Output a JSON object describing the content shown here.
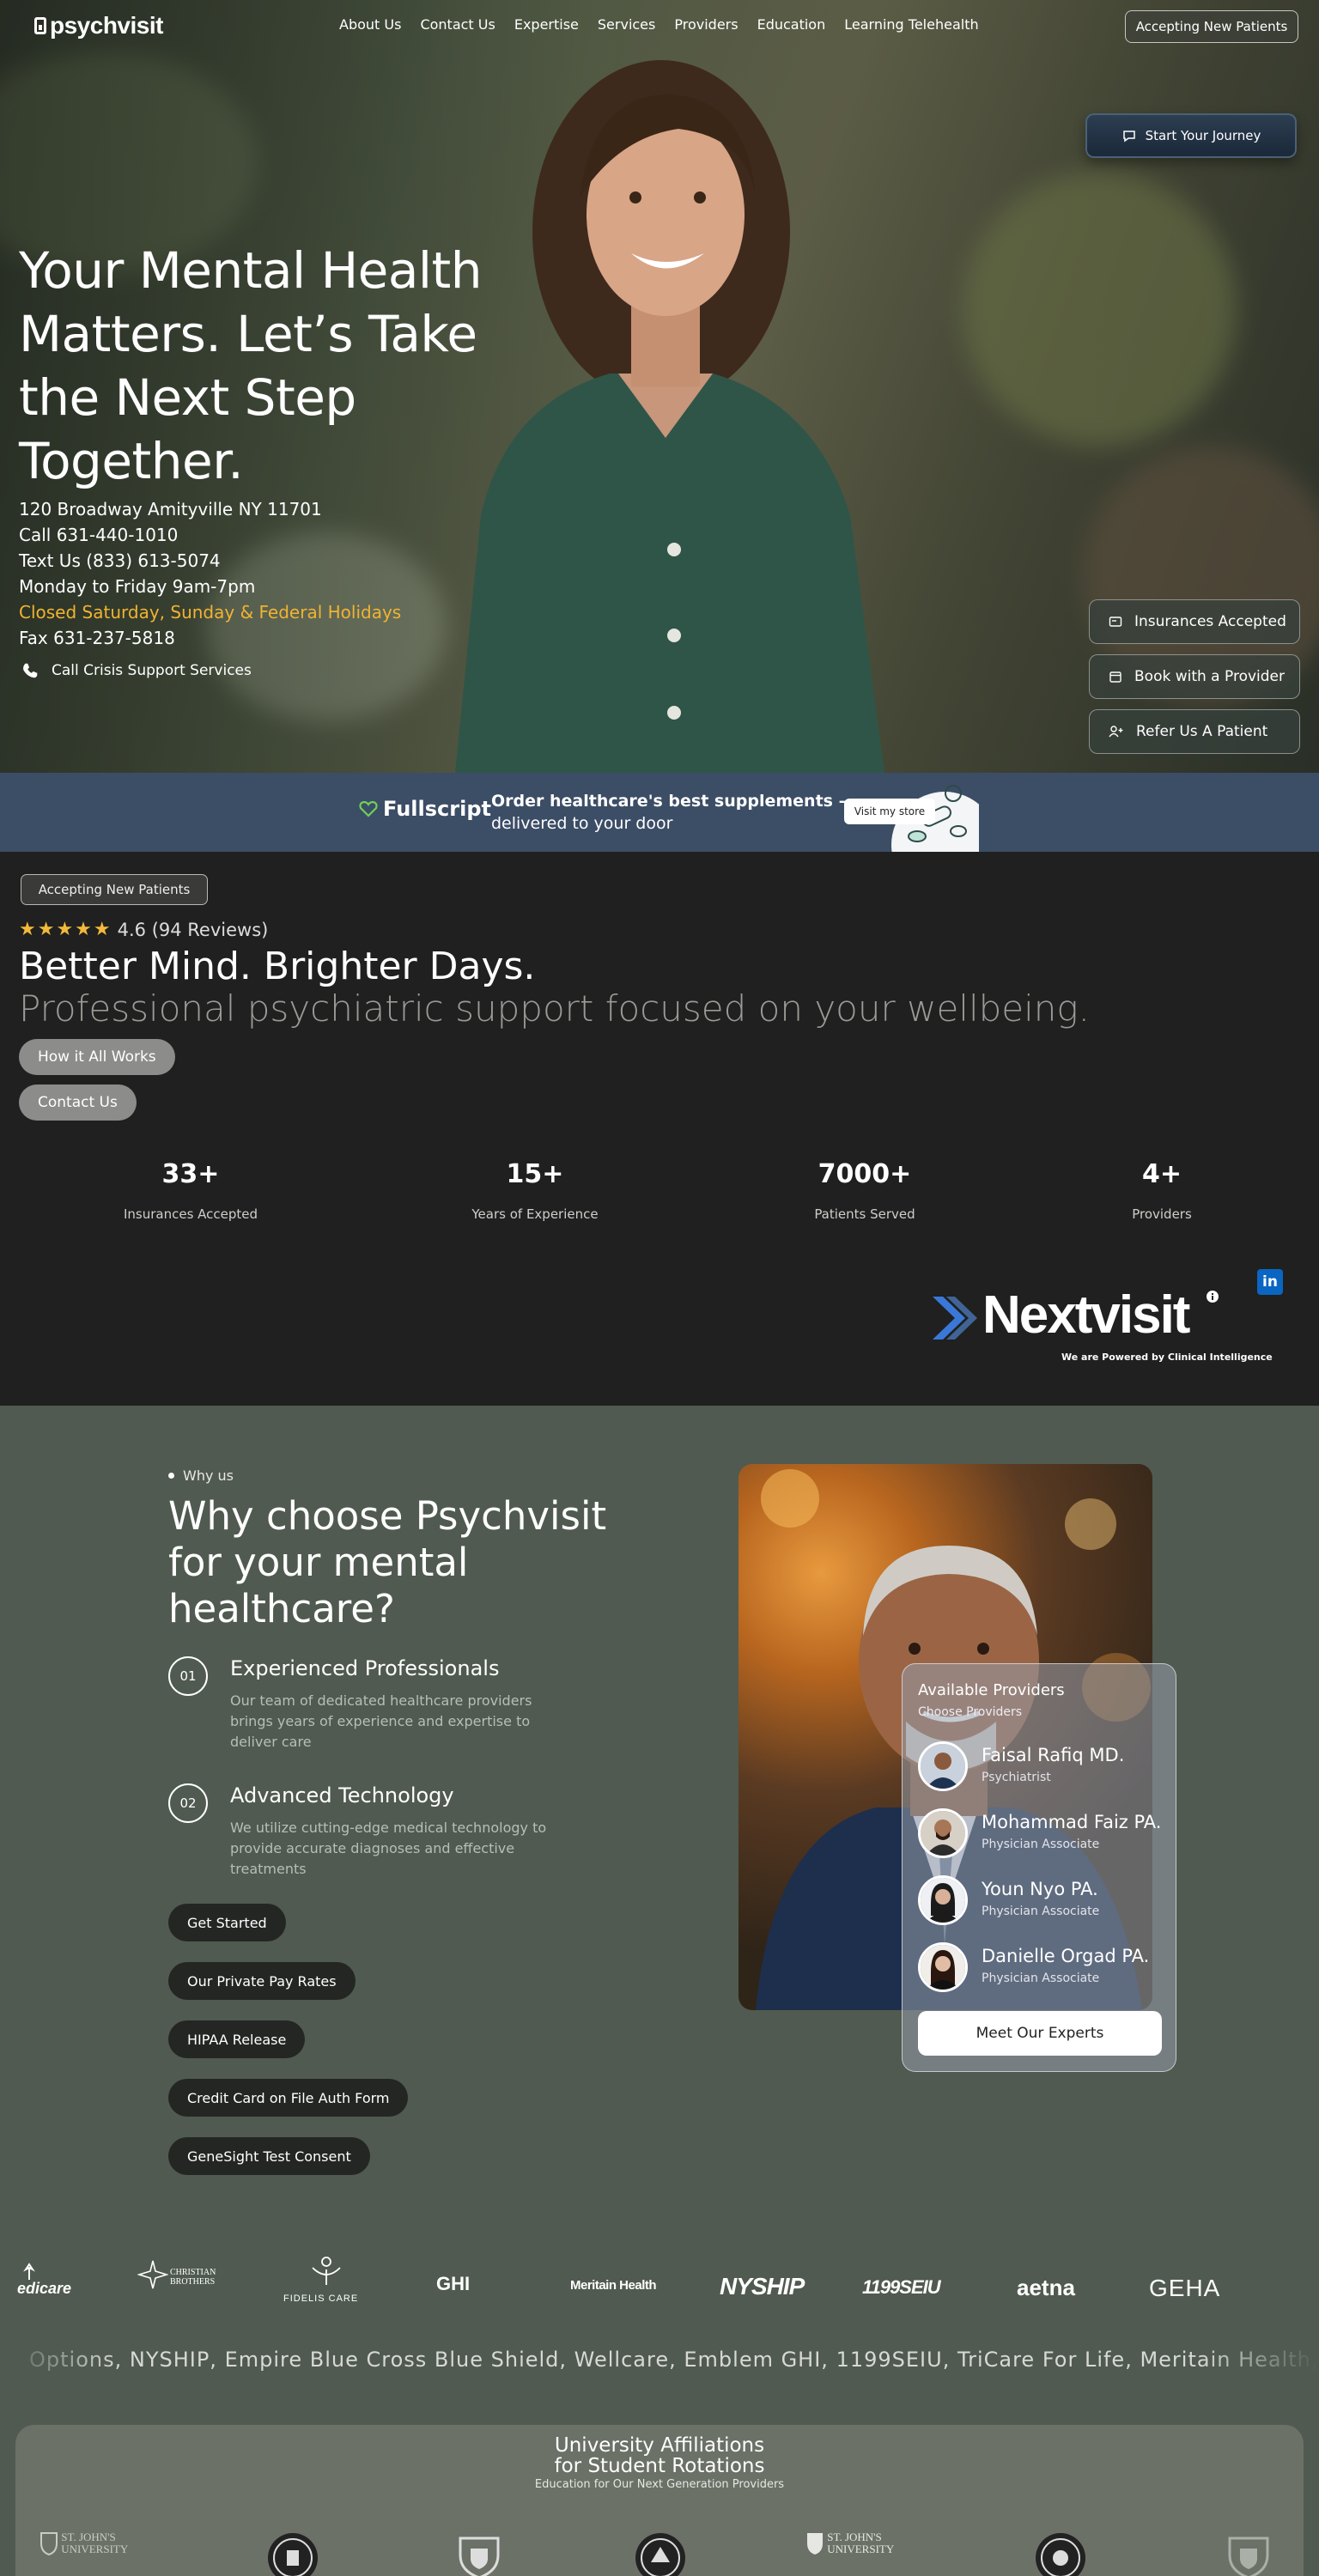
{
  "nav": {
    "logo": "psychvisit",
    "links": [
      "About Us",
      "Contact Us",
      "Expertise",
      "Services",
      "Providers",
      "Education",
      "Learning Telehealth"
    ],
    "accepting": "Accepting New Patients"
  },
  "hero": {
    "cta": "Start Your Journey",
    "title": "Your Mental Health Matters. Let’s Take the Next Step Together.",
    "address": "120 Broadway Amityville NY 11701",
    "call": "Call 631-440-1010",
    "text": "Text Us (833) 613-5074",
    "hours": "Monday to Friday 9am-7pm",
    "closed": "Closed Saturday, Sunday & Federal Holidays",
    "fax": "Fax 631-237-5818",
    "crisis": "Call Crisis Support Services",
    "side_buttons": [
      "Insurances Accepted",
      "Book with a Provider",
      "Refer Us A Patient"
    ],
    "colors": {
      "holiday": "#f0b431",
      "cta_bg": "#1a2838"
    }
  },
  "fullscript": {
    "brand": "Fullscript",
    "headline": "Order healthcare's best supplements —",
    "sub": "delivered to your door",
    "button": "Visit my store"
  },
  "intro": {
    "accepting": "Accepting New Patients",
    "stars": "★★★★★",
    "rating": "4.6 (94 Reviews)",
    "title": "Better Mind. Brighter Days.",
    "subtitle": "Professional psychiatric support focused on your wellbeing.",
    "btn_how": "How it All Works",
    "btn_contact": "Contact Us",
    "stats": [
      {
        "num": "33+",
        "label": "Insurances Accepted"
      },
      {
        "num": "15+",
        "label": "Years of Experience"
      },
      {
        "num": "7000+",
        "label": "Patients Served"
      },
      {
        "num": "4+",
        "label": "Providers"
      }
    ],
    "nextvisit": "Nextvisit",
    "nextvisit_tag": "We are Powered by Clinical Intelligence",
    "linkedin": "in"
  },
  "why": {
    "tag": "Why us",
    "title": "Why choose Psychvisit for your mental healthcare?",
    "features": [
      {
        "num": "01",
        "title": "Experienced Professionals",
        "desc": "Our team of dedicated healthcare providers brings years of experience and expertise to deliver care"
      },
      {
        "num": "02",
        "title": "Advanced Technology",
        "desc": "We utilize cutting-edge medical technology to provide accurate diagnoses and effective treatments"
      }
    ],
    "buttons": [
      "Get Started",
      "Our Private Pay Rates",
      "HIPAA Release",
      "Credit Card on File Auth Form",
      "GeneSight Test Consent"
    ],
    "providers_title": "Available Providers",
    "providers_sub": "Choose Providers",
    "providers": [
      {
        "name": "Faisal Rafiq MD.",
        "role": "Psychiatrist"
      },
      {
        "name": "Mohammad Faiz PA.",
        "role": "Physician Associate"
      },
      {
        "name": "Youn Nyo PA.",
        "role": "Physician Associate"
      },
      {
        "name": "Danielle Orgad PA.",
        "role": "Physician Associate"
      }
    ],
    "meet": "Meet Our Experts"
  },
  "insurance_logos": [
    "edicare",
    "CHRISTIAN BROTHERS",
    "FIDELIS CARE",
    "GHI",
    "Meritain Health",
    "NYSHIP",
    "1199SEIU",
    "aetna",
    "GEHA"
  ],
  "ticker": "Options, NYSHIP, Empire Blue Cross Blue Shield, Wellcare, Emblem GHI, 1199SEIU, TriCare For Life, Meritain Health, ASGHEA, M",
  "university": {
    "title1": "University Affiliations",
    "title2": "for Student Rotations",
    "subtitle": "Education for Our Next Generation Providers",
    "logos": [
      "ST. JOHN'S UNIVERSITY",
      "ST. JOHN'S UNIVERSITY"
    ]
  }
}
